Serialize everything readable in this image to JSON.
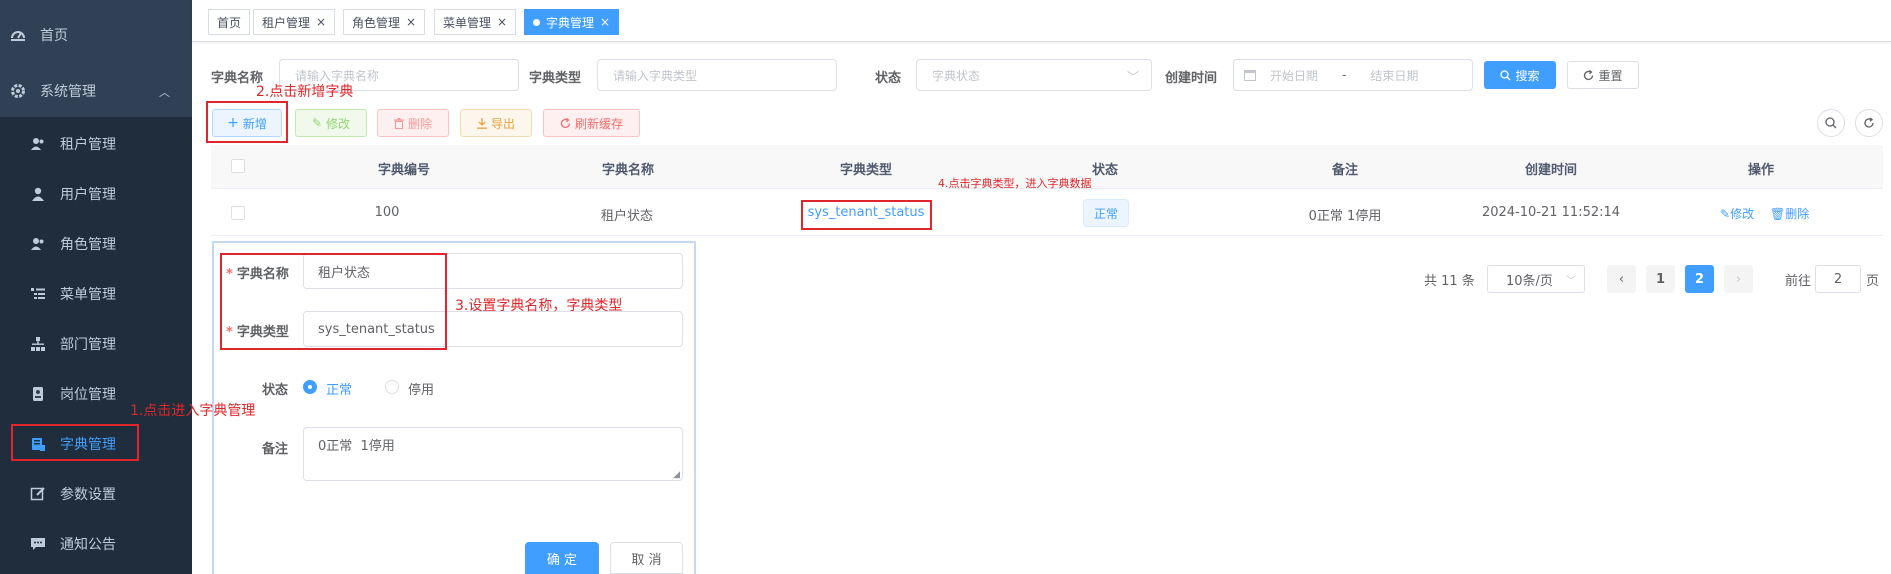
{
  "sidebar": {
    "home": "首页",
    "system": "系统管理",
    "items": [
      {
        "label": "租户管理",
        "icon": "tenant-icon"
      },
      {
        "label": "用户管理",
        "icon": "user-icon"
      },
      {
        "label": "角色管理",
        "icon": "role-icon"
      },
      {
        "label": "菜单管理",
        "icon": "menu-icon"
      },
      {
        "label": "部门管理",
        "icon": "dept-icon"
      },
      {
        "label": "岗位管理",
        "icon": "post-icon"
      },
      {
        "label": "字典管理",
        "icon": "dict-icon",
        "active": true
      },
      {
        "label": "参数设置",
        "icon": "edit-icon"
      },
      {
        "label": "通知公告",
        "icon": "message-icon"
      }
    ]
  },
  "tags": [
    "首页",
    "租户管理",
    "角色管理",
    "菜单管理",
    "字典管理"
  ],
  "search": {
    "dict_name_label": "字典名称",
    "dict_name_placeholder": "请输入字典名称",
    "dict_type_label": "字典类型",
    "dict_type_placeholder": "请输入字典类型",
    "status_label": "状态",
    "status_placeholder": "字典状态",
    "created_label": "创建时间",
    "start_placeholder": "开始日期",
    "date_sep": "-",
    "end_placeholder": "结束日期",
    "search_btn": "搜索",
    "reset_btn": "重置"
  },
  "toolbar": {
    "add": "新增",
    "edit": "修改",
    "delete": "删除",
    "export": "导出",
    "refresh_cache": "刷新缓存"
  },
  "table": {
    "headers": [
      "字典编号",
      "字典名称",
      "字典类型",
      "状态",
      "备注",
      "创建时间",
      "操作"
    ],
    "rows": [
      {
        "id": "100",
        "name": "租户状态",
        "type": "sys_tenant_status",
        "status": "正常",
        "remark": "0正常 1停用",
        "created": "2024-10-21 11:52:14",
        "op_edit": "修改",
        "op_delete": "删除"
      }
    ]
  },
  "pagination": {
    "total": "共 11 条",
    "page_size": "10条/页",
    "pages": [
      "1",
      "2"
    ],
    "current": "2",
    "goto_prefix": "前往",
    "goto_value": "2",
    "goto_suffix": "页"
  },
  "dialog": {
    "name_label": "字典名称",
    "name_value": "租户状态",
    "type_label": "字典类型",
    "type_value": "sys_tenant_status",
    "status_label": "状态",
    "status_normal": "正常",
    "status_disabled": "停用",
    "remark_label": "备注",
    "remark_value": "0正常  1停用",
    "confirm": "确 定",
    "cancel": "取 消"
  },
  "annotations": {
    "step1": "1.点击进入字典管理",
    "step2": "2.点击新增字典",
    "step3": "3.设置字典名称，字典类型",
    "step4": "4.点击字典类型，进入字典数据"
  },
  "colors": {
    "sidebar_bg": "#304156",
    "submenu_bg": "#1f2d3d",
    "primary": "#409eff",
    "annotation": "#e0262a"
  }
}
